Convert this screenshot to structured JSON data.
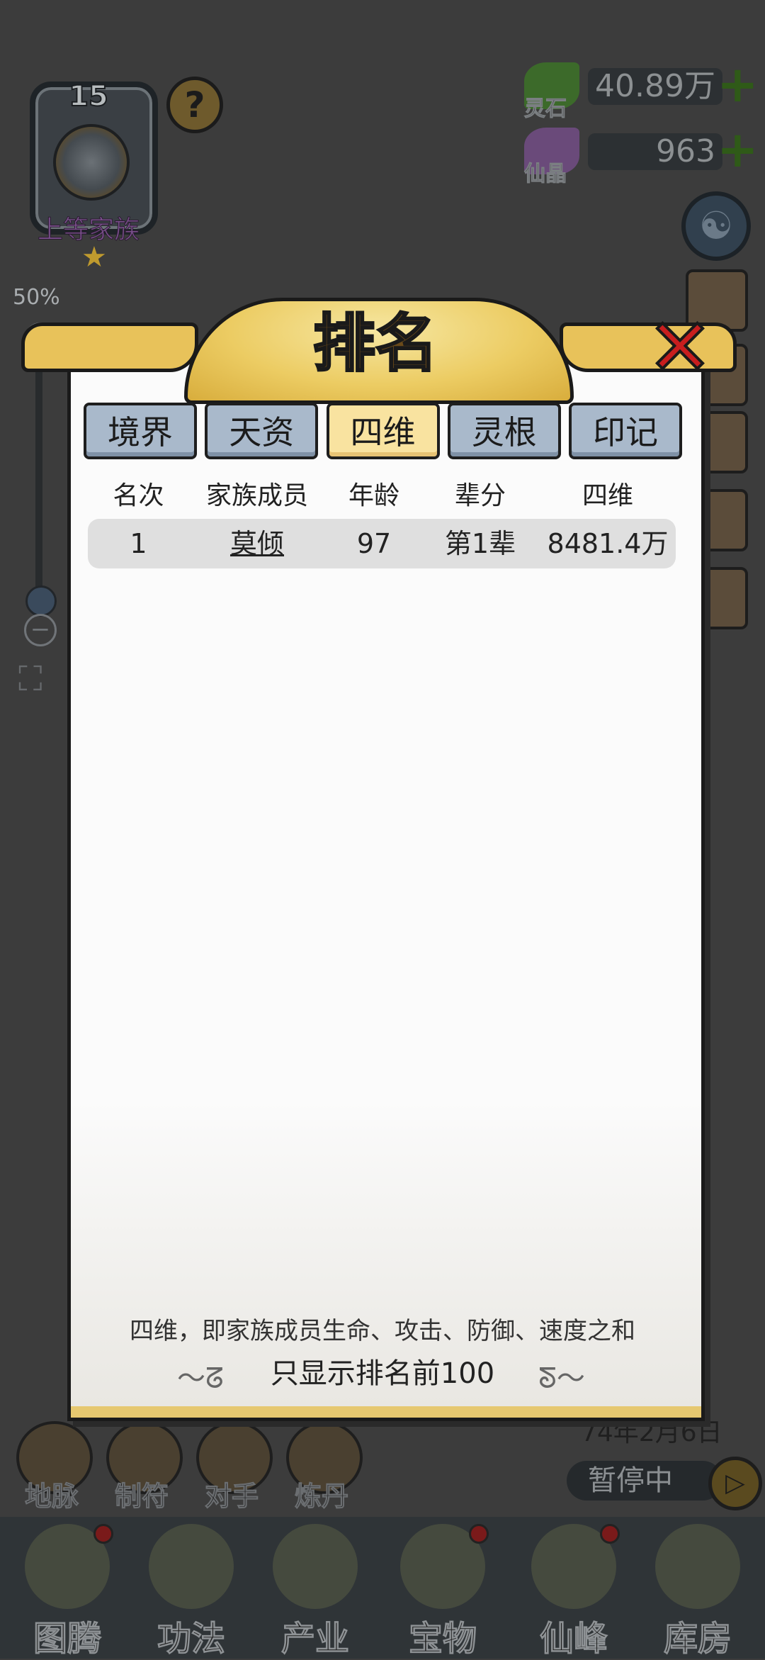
{
  "family": {
    "level": "15",
    "tier_name": "上等家族"
  },
  "help_label": "?",
  "currencies": [
    {
      "name": "灵石",
      "value": "40.89万",
      "plus": "+",
      "color": "#3c6a2a"
    },
    {
      "name": "仙晶",
      "value": "963",
      "plus": "+",
      "color": "#6a4a7a"
    }
  ],
  "zoom": {
    "percent": "50%",
    "plus": "+",
    "minus": "−"
  },
  "skills": [
    {
      "label": "地脉"
    },
    {
      "label": "制符"
    },
    {
      "label": "对手"
    },
    {
      "label": "炼丹"
    }
  ],
  "game_date": "74年2月6日",
  "pause": {
    "label": "暂停中",
    "icon": "play-icon",
    "glyph": "▷"
  },
  "bottom_nav": [
    {
      "label": "图腾",
      "has_dot": true
    },
    {
      "label": "功法",
      "has_dot": false
    },
    {
      "label": "产业",
      "has_dot": false
    },
    {
      "label": "宝物",
      "has_dot": true
    },
    {
      "label": "仙峰",
      "has_dot": true
    },
    {
      "label": "库房",
      "has_dot": false
    }
  ],
  "ranking_panel": {
    "title": "排名",
    "close_glyph": "✕",
    "tabs": [
      {
        "label": "境界",
        "active": false
      },
      {
        "label": "天资",
        "active": false
      },
      {
        "label": "四维",
        "active": true
      },
      {
        "label": "灵根",
        "active": false
      },
      {
        "label": "印记",
        "active": false
      }
    ],
    "columns": [
      "名次",
      "家族成员",
      "年龄",
      "辈分",
      "四维"
    ],
    "rows": [
      {
        "rank": "1",
        "member": "莫倾",
        "age": "97",
        "generation": "第1辈",
        "stat": "8481.4万"
      }
    ],
    "footnote": "四维，即家族成员生命、攻击、防御、速度之和",
    "limit_note": "只显示排名前100",
    "accent_color": "#f9e3a0",
    "tab_color": "#a9b9cb"
  }
}
